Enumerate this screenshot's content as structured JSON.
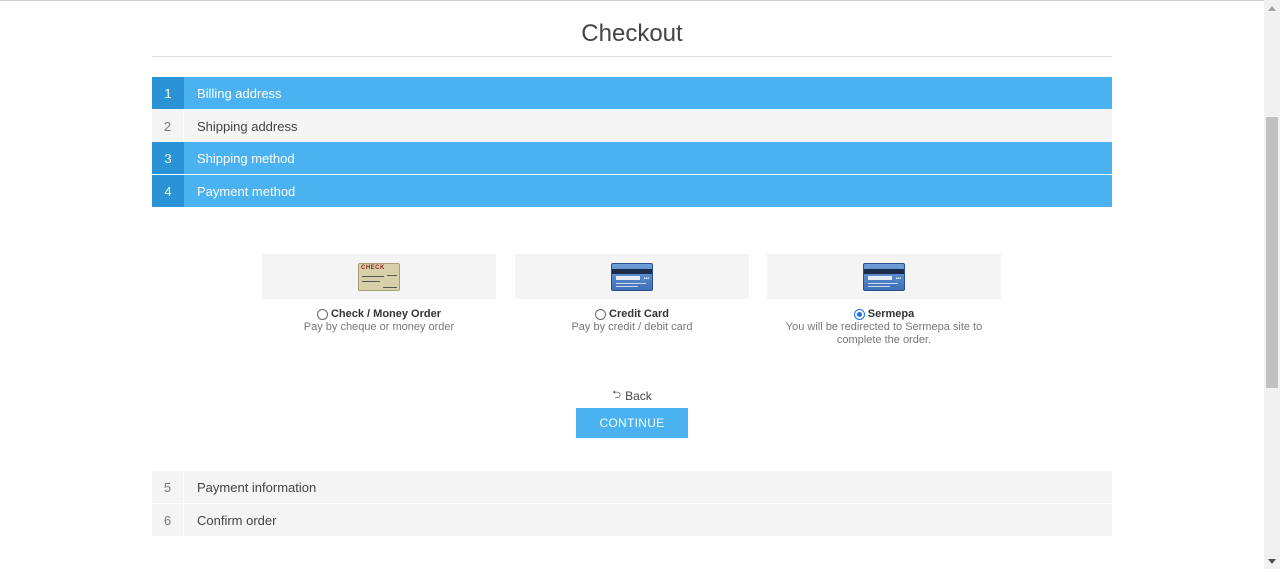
{
  "page": {
    "title": "Checkout"
  },
  "steps": [
    {
      "num": "1",
      "label": "Billing address",
      "state": "active"
    },
    {
      "num": "2",
      "label": "Shipping address",
      "state": "inactive"
    },
    {
      "num": "3",
      "label": "Shipping method",
      "state": "active"
    },
    {
      "num": "4",
      "label": "Payment method",
      "state": "active"
    },
    {
      "num": "5",
      "label": "Payment information",
      "state": "inactive"
    },
    {
      "num": "6",
      "label": "Confirm order",
      "state": "inactive"
    }
  ],
  "payment_methods": [
    {
      "name": "Check / Money Order",
      "description": "Pay by cheque or money order",
      "selected": false,
      "icon": "check-icon",
      "icon_text": "CHECK"
    },
    {
      "name": "Credit Card",
      "description": "Pay by credit / debit card",
      "selected": false,
      "icon": "credit-card-icon"
    },
    {
      "name": "Sermepa",
      "description": "You will be redirected to Sermepa site to complete the order.",
      "selected": true,
      "icon": "credit-card-icon"
    }
  ],
  "actions": {
    "back_label": "Back",
    "continue_label": "CONTINUE"
  },
  "colors": {
    "accent": "#4ab2f1",
    "accent_dark": "#2a93d5",
    "inactive_bg": "#f4f4f4"
  }
}
